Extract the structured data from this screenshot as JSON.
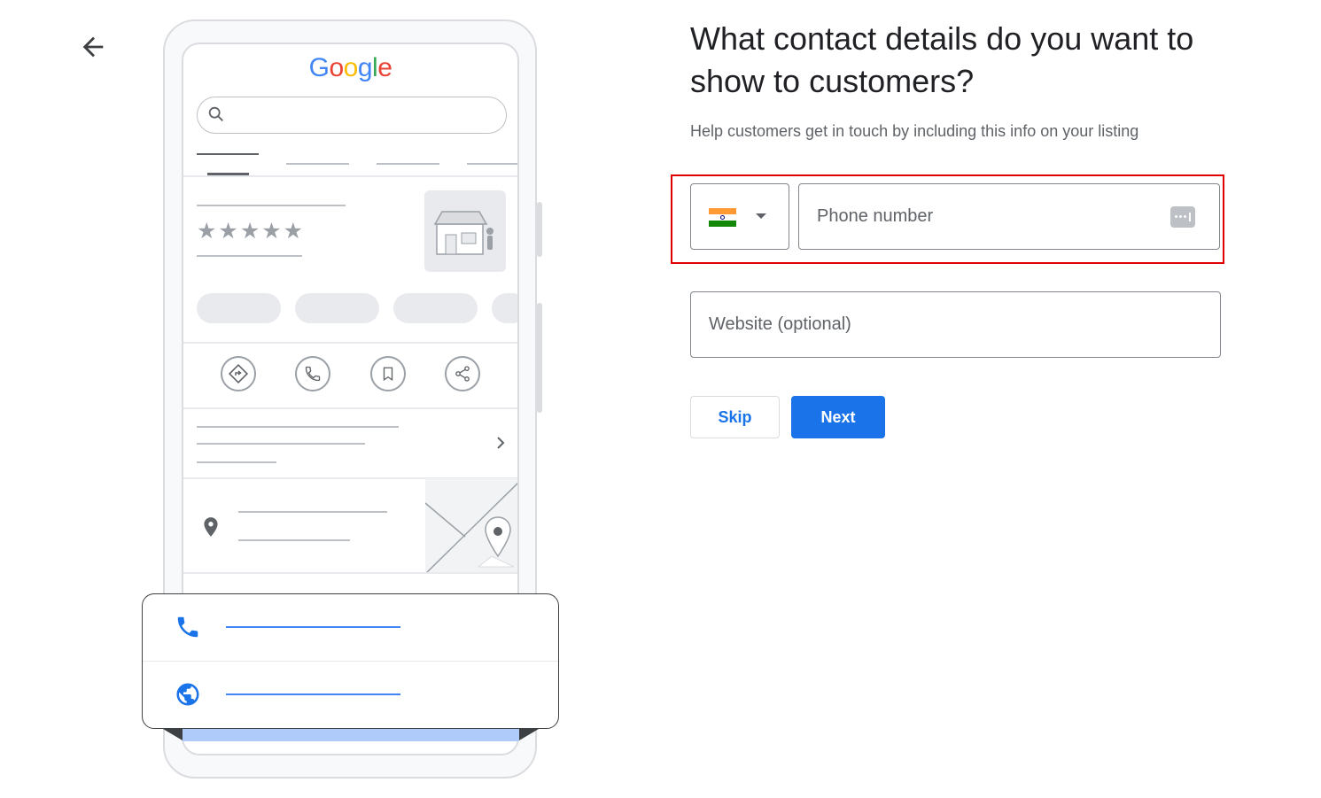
{
  "page": {
    "title": "What contact details do you want to show to customers?",
    "subtitle": "Help customers get in touch by including this info on your listing"
  },
  "illustration": {
    "logo_text": "Google",
    "stars": "★★★★★"
  },
  "form": {
    "country": {
      "flag": "india-flag-icon",
      "colors": [
        "#FF9933",
        "#FFFFFF",
        "#138808"
      ]
    },
    "phone_placeholder": "Phone number",
    "website_placeholder": "Website (optional)"
  },
  "buttons": {
    "skip": "Skip",
    "next": "Next"
  },
  "colors": {
    "primary": "#1a73e8",
    "highlight": "#e00000",
    "text": "#202124",
    "secondary_text": "#5f6368"
  }
}
